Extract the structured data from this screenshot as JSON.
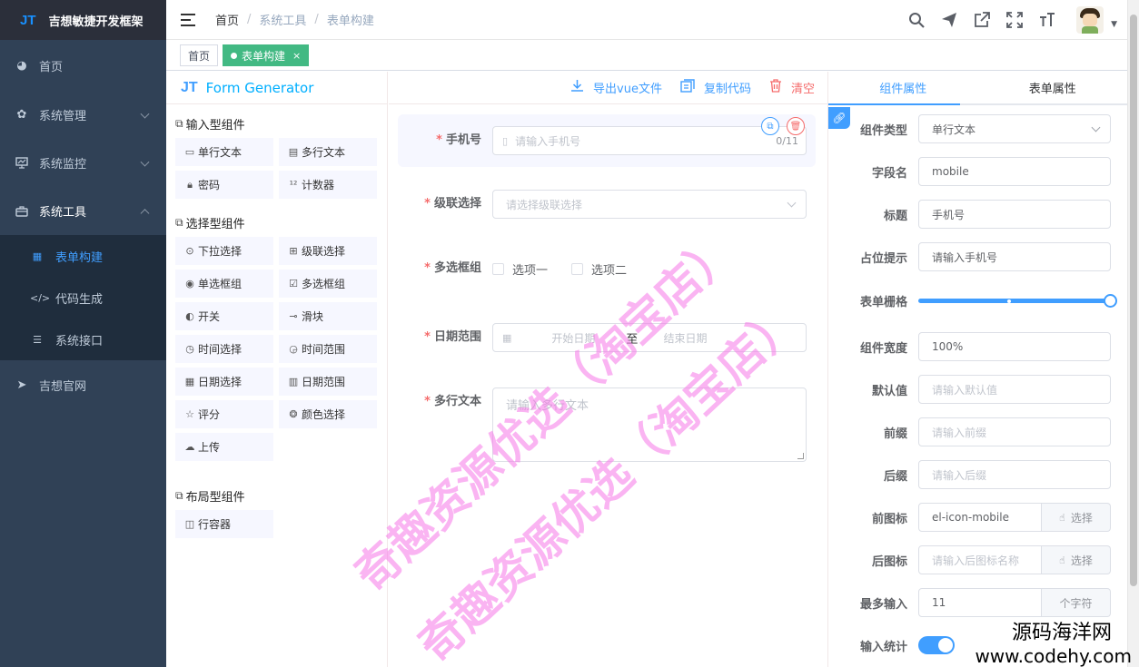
{
  "app": {
    "logo_mark": "JT",
    "title": "吉想敏捷开发框架"
  },
  "sidebar": {
    "items": [
      {
        "label": "首页",
        "icon": "dashboard-icon"
      },
      {
        "label": "系统管理",
        "icon": "gear-icon"
      },
      {
        "label": "系统监控",
        "icon": "monitor-icon"
      },
      {
        "label": "系统工具",
        "icon": "toolbox-icon"
      }
    ],
    "subitems": [
      {
        "label": "表单构建",
        "icon": "grid-icon",
        "active": true
      },
      {
        "label": "代码生成",
        "icon": "code-icon"
      },
      {
        "label": "系统接口",
        "icon": "sliders-icon"
      }
    ],
    "extra": {
      "label": "吉想官网",
      "icon": "send-icon"
    }
  },
  "navbar": {
    "breadcrumb": [
      "首页",
      "系统工具",
      "表单构建"
    ],
    "icons": [
      "search-icon",
      "paper-plane-icon",
      "external-link-icon",
      "fullscreen-icon",
      "font-size-icon"
    ]
  },
  "tags": {
    "home": "首页",
    "active": "表单构建",
    "close": "×"
  },
  "generator": {
    "logo_mark": "JT",
    "title": "Form Generator"
  },
  "components": {
    "input_title": "输入型组件",
    "input": [
      "单行文本",
      "多行文本",
      "密码",
      "计数器"
    ],
    "select_title": "选择型组件",
    "select": [
      "下拉选择",
      "级联选择",
      "单选框组",
      "多选框组",
      "开关",
      "滑块",
      "时间选择",
      "时间范围",
      "日期选择",
      "日期范围",
      "评分",
      "颜色选择",
      "上传"
    ],
    "layout_title": "布局型组件",
    "layout": [
      "行容器"
    ]
  },
  "toolbar": {
    "export": "导出vue文件",
    "copy": "复制代码",
    "clear": "清空"
  },
  "form": {
    "phone": {
      "label": "手机号",
      "placeholder": "请输入手机号",
      "count": "0/11"
    },
    "cascader": {
      "label": "级联选择",
      "placeholder": "请选择级联选择"
    },
    "checkbox": {
      "label": "多选框组",
      "options": [
        "选项一",
        "选项二"
      ]
    },
    "daterange": {
      "label": "日期范围",
      "start": "开始日期",
      "sep": "至",
      "end": "结束日期"
    },
    "textarea": {
      "label": "多行文本",
      "placeholder": "请输入多行文本"
    }
  },
  "props": {
    "tabs": [
      "组件属性",
      "表单属性"
    ],
    "rows": {
      "type": {
        "label": "组件类型",
        "value": "单行文本"
      },
      "field": {
        "label": "字段名",
        "value": "mobile"
      },
      "title": {
        "label": "标题",
        "value": "手机号"
      },
      "placeholder": {
        "label": "占位提示",
        "value": "请输入手机号"
      },
      "span": {
        "label": "表单栅格",
        "value": 1.0
      },
      "width": {
        "label": "组件宽度",
        "value": "100%"
      },
      "default": {
        "label": "默认值",
        "placeholder": "请输入默认值"
      },
      "prefix": {
        "label": "前缀",
        "placeholder": "请输入前缀"
      },
      "suffix": {
        "label": "后缀",
        "placeholder": "请输入后缀"
      },
      "prefix_icon": {
        "label": "前图标",
        "value": "el-icon-mobile",
        "button": "选择"
      },
      "suffix_icon": {
        "label": "后图标",
        "placeholder": "请输入后图标名称",
        "button": "选择"
      },
      "maxlength": {
        "label": "最多输入",
        "value": "11",
        "append": "个字符"
      },
      "count": {
        "label": "输入统计",
        "value": true
      }
    }
  },
  "watermark": {
    "text": "奇趣资源优选（淘宝店）"
  },
  "corner": {
    "line1": "源码海洋网",
    "line2": "www.codehy.com"
  },
  "colors": {
    "sidebar": "#304156",
    "accent": "#409eff",
    "tag_active": "#42b983",
    "danger": "#f56c6c",
    "watermark": "#f576e8"
  }
}
